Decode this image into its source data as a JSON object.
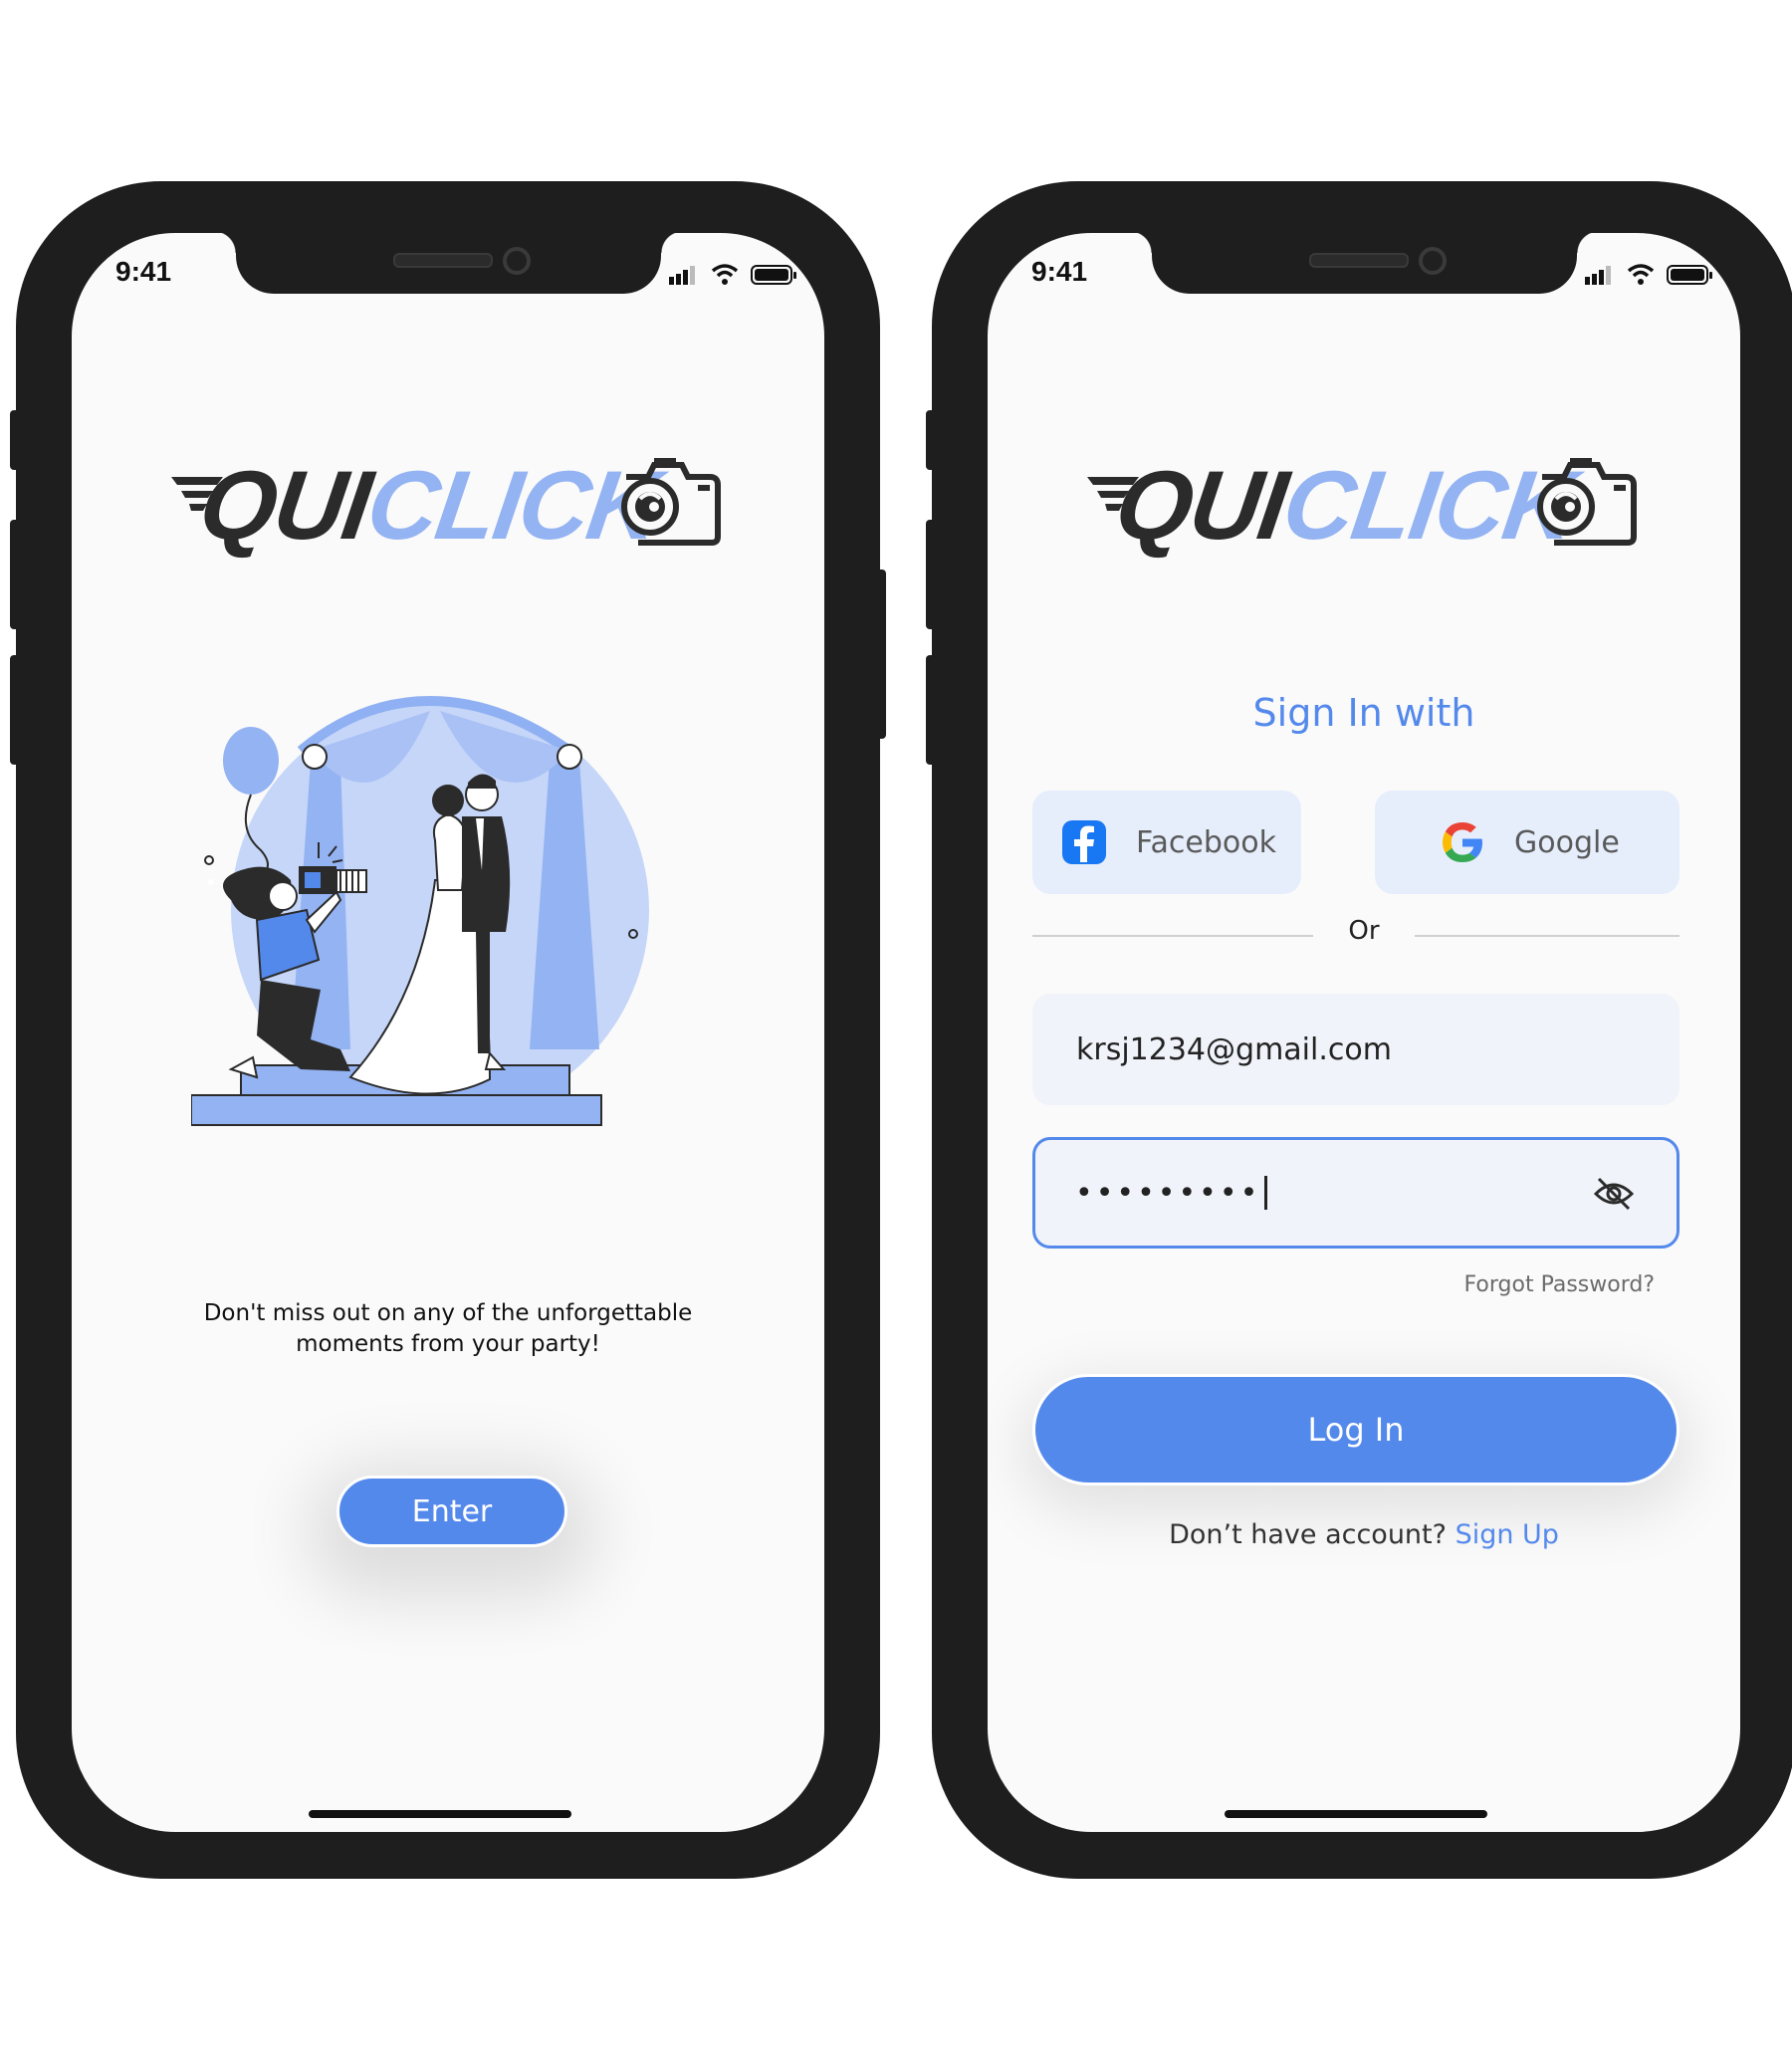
{
  "status_bar": {
    "time": "9:41"
  },
  "logo": {
    "dark_part": "QUI",
    "blue_part": "CLICK"
  },
  "welcome": {
    "tagline_line1": "Don't miss out on any of the unforgettable",
    "tagline_line2": "moments from your party!",
    "enter_label": "Enter"
  },
  "login": {
    "title": "Sign In with",
    "facebook_label": "Facebook",
    "google_label": "Google",
    "divider": "Or",
    "email_value": "krsj1234@gmail.com",
    "password_mask": "•••••••••",
    "forgot_label": "Forgot Password?",
    "login_label": "Log In",
    "no_account_text": "Don’t have account?",
    "signup_label": "Sign Up"
  },
  "colors": {
    "accent": "#5489ec",
    "logo_blue": "#94b3f2",
    "logo_dark": "#2b2b2b",
    "frame": "#1e1e1e",
    "screen_bg": "#fafafa",
    "field_bg": "#f0f3f9",
    "social_bg": "#e6eefc"
  },
  "icons": {
    "signal": "signal-bars-icon",
    "wifi": "wifi-icon",
    "battery": "battery-icon",
    "camera": "camera-icon",
    "facebook": "facebook-icon",
    "google": "google-icon",
    "eye_off": "eye-off-icon"
  }
}
